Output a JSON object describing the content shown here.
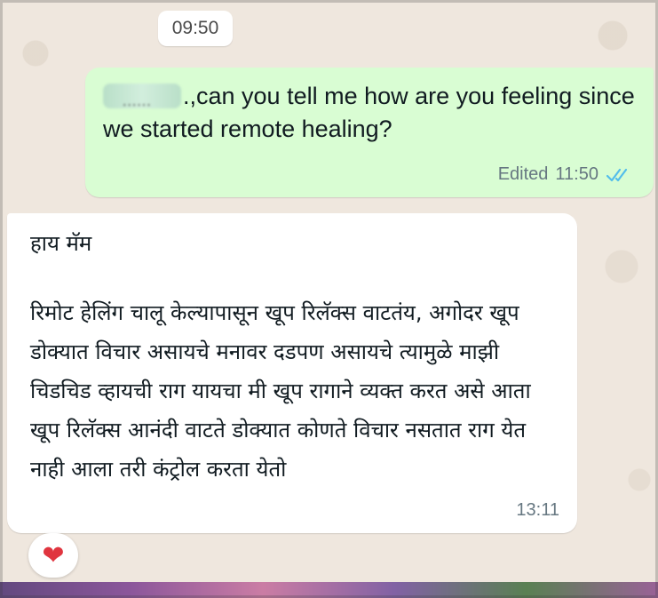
{
  "chat": {
    "date_chip": "09:50",
    "outgoing": {
      "redacted_name": "......",
      "text": ".,can you tell me how are you feeling since we started remote healing?",
      "edited_label": "Edited",
      "time": "11:50",
      "status_icon": "double-check-icon",
      "tick_color": "#53bdeb"
    },
    "incoming": {
      "greeting": "हाय मॅम",
      "body": "रिमोट हेलिंग चालू केल्यापासून खूप रिलॅक्स वाटतंय, अगोदर खूप डोक्यात विचार असायचे मनावर दडपण असायचे त्यामुळे माझी चिडचिड व्हायची राग यायचा मी खूप रागाने व्यक्त करत असे आता खूप रिलॅक्स आनंदी वाटते डोक्यात कोणते विचार नसतात राग येत नाही आला तरी कंट्रोल करता येतो",
      "time": "13:11"
    },
    "reaction": {
      "emoji": "❤",
      "icon": "heart-icon"
    }
  },
  "colors": {
    "outgoing_bubble": "#d9fdd3",
    "incoming_bubble": "#ffffff",
    "wallpaper": "#efe7de"
  }
}
